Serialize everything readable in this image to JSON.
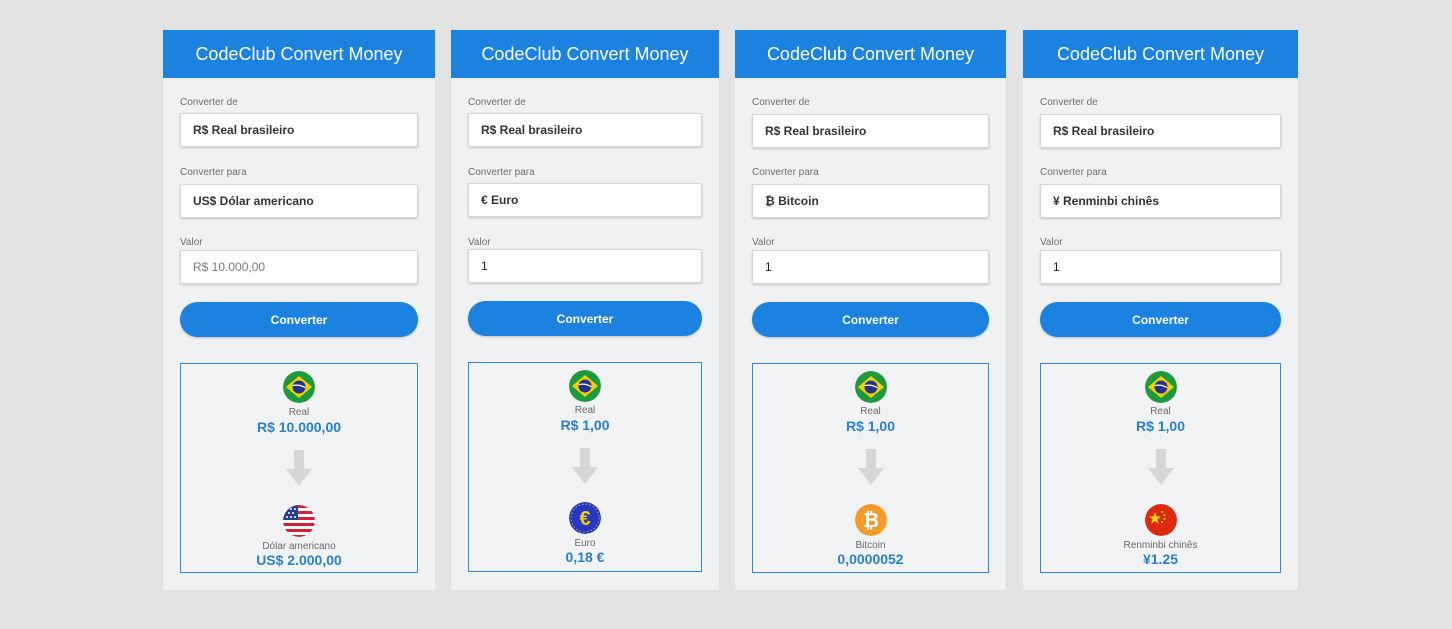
{
  "app_title": "CodeClub Convert Money",
  "labels": {
    "from": "Converter de",
    "to": "Converter para",
    "value": "Valor",
    "convert_button": "Converter"
  },
  "colors": {
    "primary": "#1b82e0",
    "value_text": "#2a7fd0",
    "background": "#e3e3e3",
    "panel": "#f0f1f2"
  },
  "panels": [
    {
      "from_select": "R$ Real brasileiro",
      "to_select": "US$ Dólar americano",
      "value_input": "",
      "value_placeholder": "R$ 10.000,00",
      "from_currency": {
        "icon": "brazil-flag-icon",
        "name": "Real",
        "value": "R$ 10.000,00"
      },
      "to_currency": {
        "icon": "usa-flag-icon",
        "name": "Dólar americano",
        "value": "US$ 2.000,00"
      }
    },
    {
      "from_select": "R$ Real brasileiro",
      "to_select": "€ Euro",
      "value_input": "1",
      "value_placeholder": "",
      "from_currency": {
        "icon": "brazil-flag-icon",
        "name": "Real",
        "value": "R$ 1,00"
      },
      "to_currency": {
        "icon": "euro-icon",
        "name": "Euro",
        "value": "0,18 €"
      }
    },
    {
      "from_select": "R$ Real brasileiro",
      "to_select": "₿ Bitcoin",
      "value_input": "1",
      "value_placeholder": "",
      "from_currency": {
        "icon": "brazil-flag-icon",
        "name": "Real",
        "value": "R$ 1,00"
      },
      "to_currency": {
        "icon": "bitcoin-icon",
        "name": "Bitcoin",
        "value": "0,0000052"
      }
    },
    {
      "from_select": "R$ Real brasileiro",
      "to_select": "¥ Renminbi chinês",
      "value_input": "1",
      "value_placeholder": "",
      "from_currency": {
        "icon": "brazil-flag-icon",
        "name": "Real",
        "value": "R$ 1,00"
      },
      "to_currency": {
        "icon": "china-flag-icon",
        "name": "Renminbi chinês",
        "value": "¥1.25"
      }
    }
  ]
}
